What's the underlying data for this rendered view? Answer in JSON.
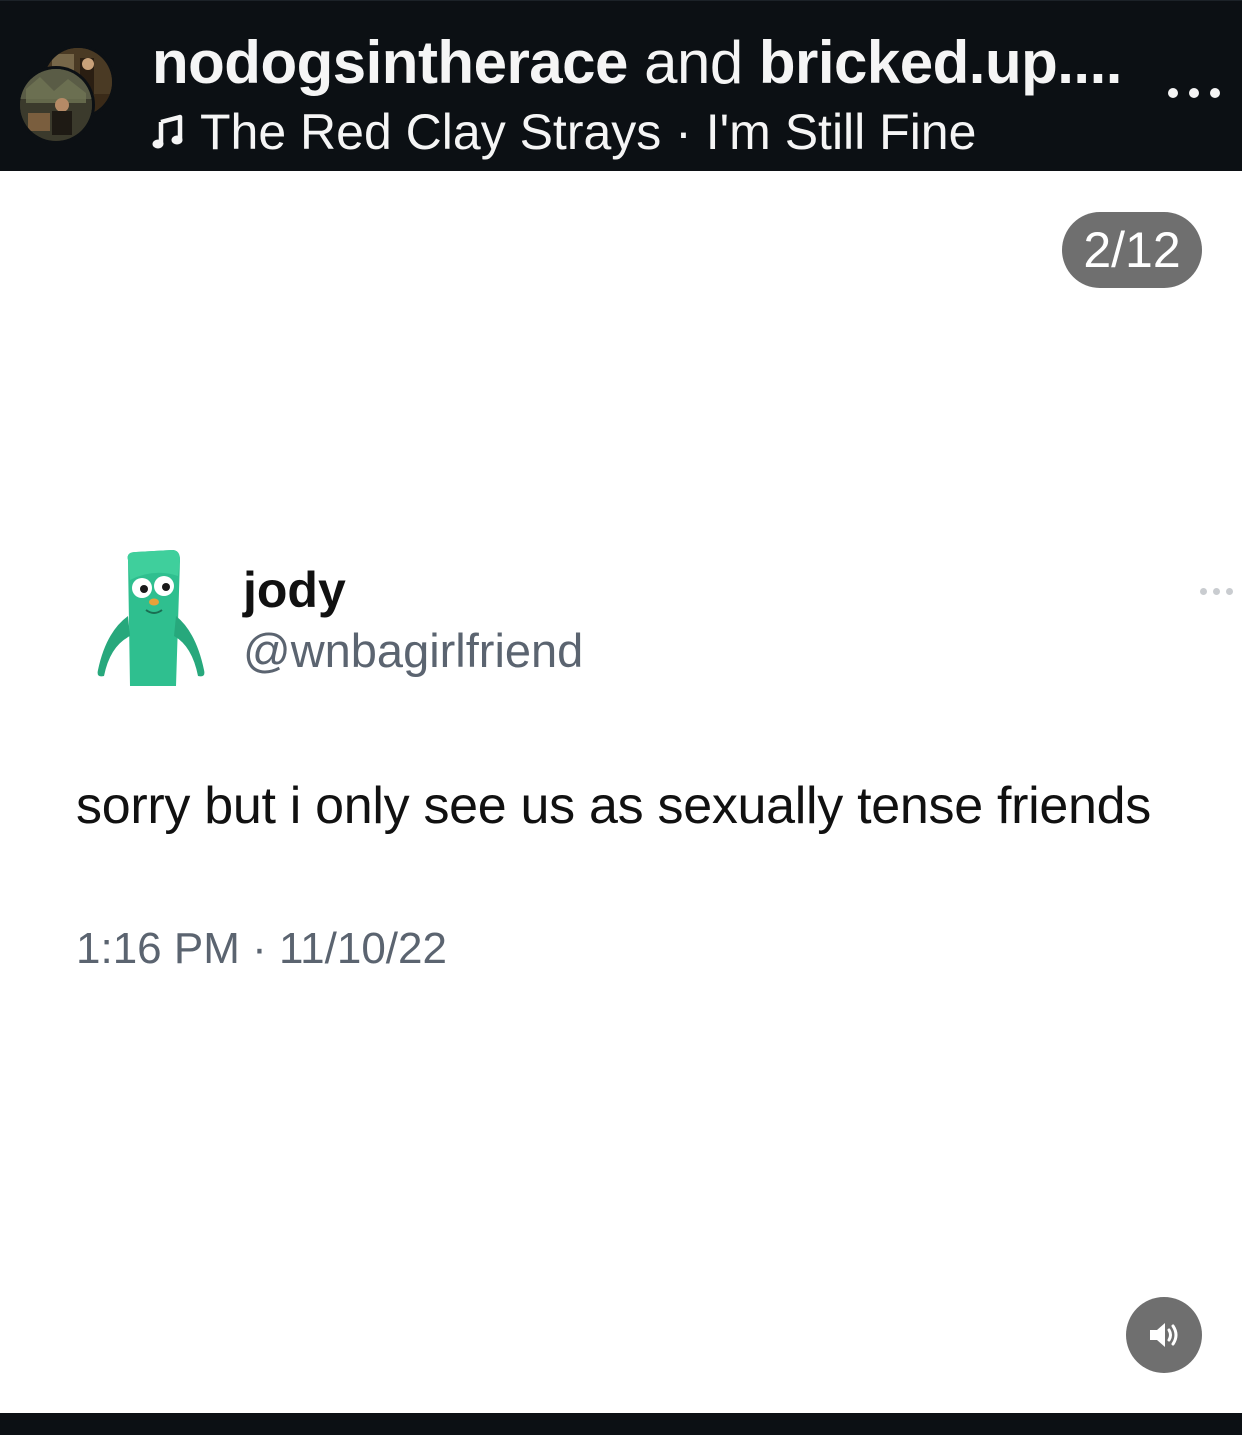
{
  "header": {
    "user_primary": "nodogsintherace",
    "connector": " and ",
    "user_secondary": "bricked.up....",
    "music_artist": "The Red Clay Strays",
    "music_separator": " · ",
    "music_title": "I'm Still Fine",
    "more_icon": "more-horizontal-icon"
  },
  "carousel": {
    "counter": "2/12"
  },
  "tweet": {
    "display_name": "jody",
    "handle": "@wnbagirlfriend",
    "text": "sorry but i only see us as sexually tense friends",
    "timestamp": "1:16 PM · 11/10/22"
  },
  "controls": {
    "sound_icon": "speaker-icon"
  },
  "colors": {
    "header_bg": "#0c1014",
    "badge_bg": "#6f6f6f",
    "avatar_green": "#2fbf8f"
  }
}
